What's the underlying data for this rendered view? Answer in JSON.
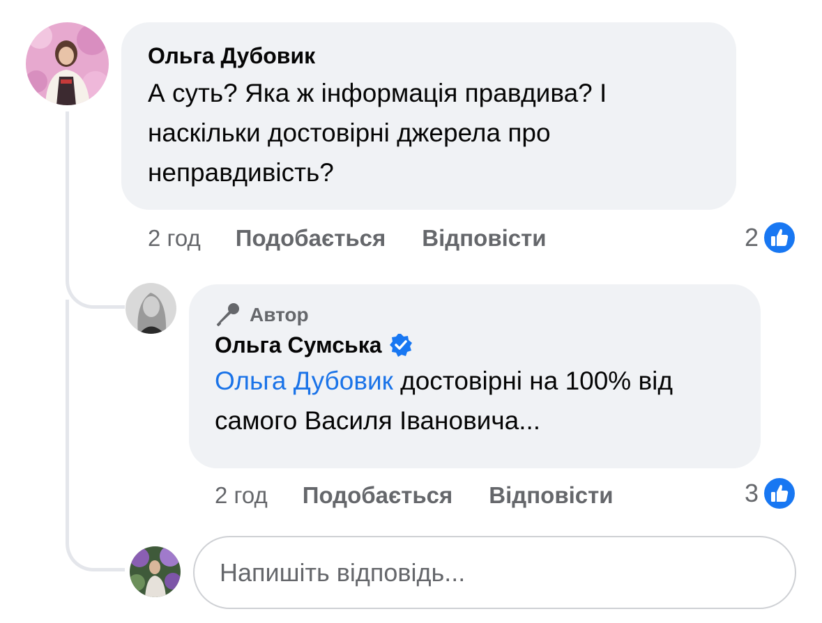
{
  "comment": {
    "author": "Ольга Дубовик",
    "text": "А суть? Яка ж інформація правдива? І наскільки достовірні джерела про неправдивість?",
    "time": "2 год",
    "like_label": "Подобається",
    "reply_label": "Відповісти",
    "reaction_count": "2",
    "avatar_icon": "avatar-photo"
  },
  "reply": {
    "badge_label": "Автор",
    "badge_icon": "microphone-icon",
    "author": "Ольга Сумська",
    "verified_icon": "verified-badge-icon",
    "mention": "Ольга Дубовик",
    "text": " достовірні на 100% від самого Василя Івановича...",
    "time": "2 год",
    "like_label": "Подобається",
    "reply_label": "Відповісти",
    "reaction_count": "3",
    "avatar_icon": "avatar-photo"
  },
  "reply_box": {
    "placeholder": "Напишіть відповідь...",
    "avatar_icon": "avatar-photo"
  },
  "colors": {
    "bubble": "#f0f2f5",
    "mention": "#1a73e8",
    "like_blue": "#1877f2",
    "meta_text": "#65676b"
  }
}
